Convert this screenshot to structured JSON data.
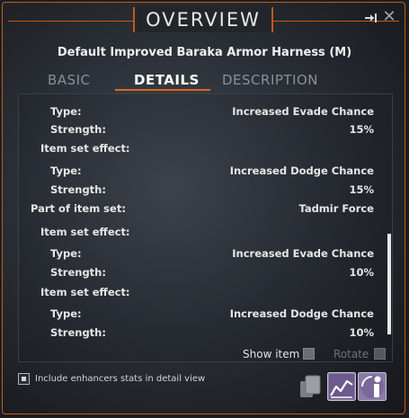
{
  "window": {
    "title": "OVERVIEW"
  },
  "item": {
    "name": "Default Improved Baraka Armor Harness (M)"
  },
  "tabs": [
    {
      "label": "BASIC",
      "active": false
    },
    {
      "label": "DETAILS",
      "active": true
    },
    {
      "label": "DESCRIPTION",
      "active": false
    }
  ],
  "details": [
    {
      "label": "Type:",
      "value": "Increased Evade Chance"
    },
    {
      "label": "Strength:",
      "value": "15%"
    },
    {
      "label": "Item set effect:",
      "value": ""
    },
    {
      "label": "Type:",
      "value": "Increased Dodge Chance"
    },
    {
      "label": "Strength:",
      "value": "15%"
    },
    {
      "label": "Part of item set:",
      "value": "Tadmir Force"
    },
    {
      "label": "Item set effect:",
      "value": ""
    },
    {
      "label": "Type:",
      "value": "Increased Evade Chance"
    },
    {
      "label": "Strength:",
      "value": "10%"
    },
    {
      "label": "Item set effect:",
      "value": ""
    },
    {
      "label": "Type:",
      "value": "Increased Dodge Chance"
    },
    {
      "label": "Strength:",
      "value": "10%"
    }
  ],
  "controls": {
    "show_item_label": "Show item",
    "rotate_label": "Rotate",
    "include_enhancers_label": "Include enhancers stats in detail view"
  },
  "icons": {
    "pin": "pin-icon",
    "close": "close-icon",
    "compare": "compare-icon",
    "stats": "stats-chart-icon",
    "info": "info-icon"
  },
  "colors": {
    "accent": "#c65a16",
    "active_tab_underline": "#d96a1e"
  }
}
